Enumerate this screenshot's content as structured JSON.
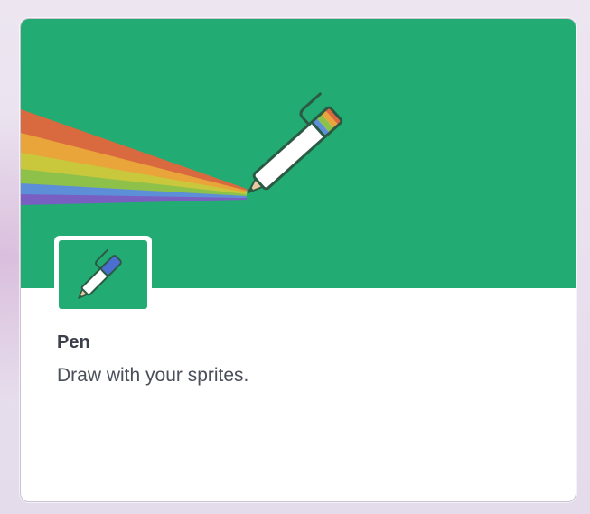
{
  "extension": {
    "title": "Pen",
    "description": "Draw with your sprites.",
    "banner_icon": "rainbow-pen-icon",
    "tile_icon": "pen-icon"
  },
  "colors": {
    "banner": "#22ab72",
    "card_background": "#ffffff",
    "title_text": "#3a3f4a",
    "description_text": "#4a4f5a"
  }
}
